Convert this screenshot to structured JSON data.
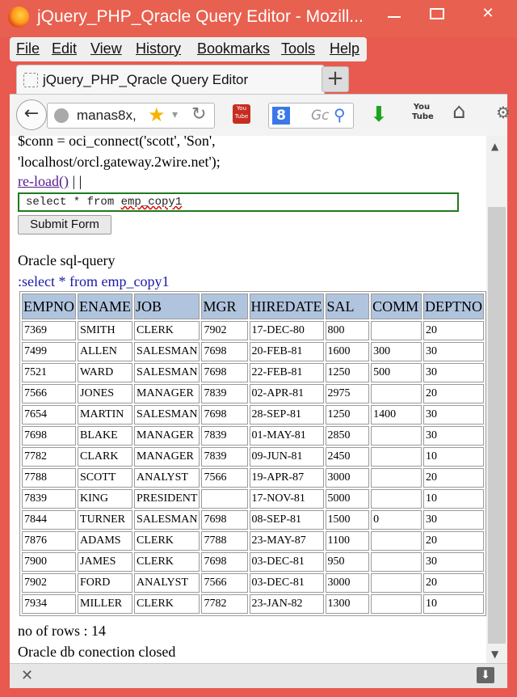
{
  "window": {
    "title": "jQuery_PHP_Qracle Query Editor - Mozill...",
    "minimize": "",
    "maximize": "",
    "close": "✕"
  },
  "menubar": {
    "file": "File",
    "edit": "Edit",
    "view": "View",
    "history": "History",
    "bookmarks": "Bookmarks",
    "tools": "Tools",
    "help": "Help"
  },
  "tabs": {
    "active_label": "jQuery_PHP_Qracle Query Editor",
    "newtab": "+"
  },
  "navbar": {
    "back": "←",
    "url": "manas8x,",
    "star": "★",
    "dropdown": "▾",
    "reload": "↻",
    "search_engine": "8",
    "search_placeholder": "Gc",
    "search_icon": "⚲",
    "download_icon": "⬇",
    "youtube_text": "You Tube",
    "home_icon": "⌂",
    "gear_icon": "⚙"
  },
  "content": {
    "code_line1": "$conn = oci_connect('scott', 'Son',",
    "code_line2": "'localhost/orcl.gateway.2wire.net');",
    "reload_link": "re-load()",
    "reload_suffix": " | |",
    "sql_prefix": "select * from  ",
    "sql_table": "emp_copy1",
    "submit": "Submit Form",
    "heading": "Oracle sql-query",
    "query_echo": ":select * from emp_copy1",
    "row_count": "no of rows : 14",
    "closed_msg": "Oracle db conection closed"
  },
  "table": {
    "columns": [
      "EMPNO",
      "ENAME",
      "JOB",
      "MGR",
      "HIREDATE",
      "SAL",
      "COMM",
      "DEPTNO"
    ],
    "rows": [
      [
        "7369",
        "SMITH",
        "CLERK",
        "7902",
        "17-DEC-80",
        "800",
        "",
        "20"
      ],
      [
        "7499",
        "ALLEN",
        "SALESMAN",
        "7698",
        "20-FEB-81",
        "1600",
        "300",
        "30"
      ],
      [
        "7521",
        "WARD",
        "SALESMAN",
        "7698",
        "22-FEB-81",
        "1250",
        "500",
        "30"
      ],
      [
        "7566",
        "JONES",
        "MANAGER",
        "7839",
        "02-APR-81",
        "2975",
        "",
        "20"
      ],
      [
        "7654",
        "MARTIN",
        "SALESMAN",
        "7698",
        "28-SEP-81",
        "1250",
        "1400",
        "30"
      ],
      [
        "7698",
        "BLAKE",
        "MANAGER",
        "7839",
        "01-MAY-81",
        "2850",
        "",
        "30"
      ],
      [
        "7782",
        "CLARK",
        "MANAGER",
        "7839",
        "09-JUN-81",
        "2450",
        "",
        "10"
      ],
      [
        "7788",
        "SCOTT",
        "ANALYST",
        "7566",
        "19-APR-87",
        "3000",
        "",
        "20"
      ],
      [
        "7839",
        "KING",
        "PRESIDENT",
        "",
        "17-NOV-81",
        "5000",
        "",
        "10"
      ],
      [
        "7844",
        "TURNER",
        "SALESMAN",
        "7698",
        "08-SEP-81",
        "1500",
        "0",
        "30"
      ],
      [
        "7876",
        "ADAMS",
        "CLERK",
        "7788",
        "23-MAY-87",
        "1100",
        "",
        "20"
      ],
      [
        "7900",
        "JAMES",
        "CLERK",
        "7698",
        "03-DEC-81",
        "950",
        "",
        "30"
      ],
      [
        "7902",
        "FORD",
        "ANALYST",
        "7566",
        "03-DEC-81",
        "3000",
        "",
        "20"
      ],
      [
        "7934",
        "MILLER",
        "CLERK",
        "7782",
        "23-JAN-82",
        "1300",
        "",
        "10"
      ]
    ]
  },
  "bottombar": {
    "close": "✕",
    "download": "⬇"
  },
  "colors": {
    "titlebar": "#e8604f",
    "header_cell": "#b0c4de",
    "link": "#551a8b",
    "sql_border": "#1f7a1f"
  }
}
